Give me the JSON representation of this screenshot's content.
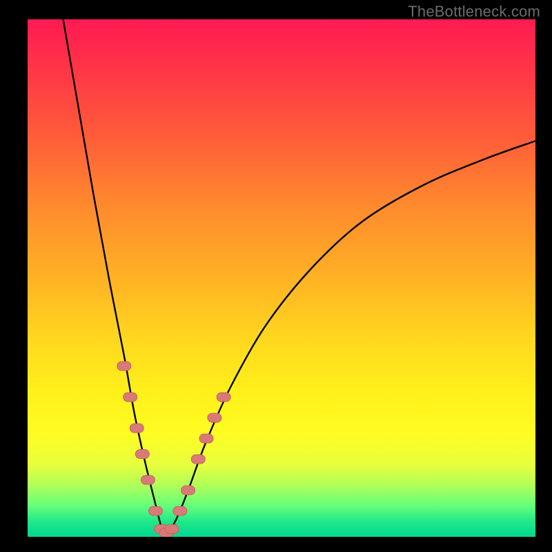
{
  "watermark": "TheBottleneck.com",
  "colors": {
    "frame": "#000000",
    "curve": "#000000",
    "marker_fill": "#d97a78",
    "marker_stroke": "#c46560",
    "gradient_top": "#ff1a52",
    "gradient_bottom": "#00d890"
  },
  "chart_data": {
    "type": "line",
    "title": "",
    "xlabel": "",
    "ylabel": "",
    "xlim": [
      0,
      100
    ],
    "ylim": [
      0,
      100
    ],
    "grid": false,
    "legend": false,
    "note": "Bottleneck-style V-curve. No axis ticks or numeric labels are rendered; y is read as percentage of plot height (0 at bottom, 100 at top). Minimum (~0) near x≈27.",
    "series": [
      {
        "name": "left-branch",
        "x": [
          7,
          10,
          13,
          16,
          19,
          21,
          23,
          25,
          26.3,
          27
        ],
        "y": [
          100,
          83,
          66,
          50,
          35,
          24,
          15,
          7,
          2,
          0.5
        ]
      },
      {
        "name": "right-branch",
        "x": [
          27,
          28.5,
          30,
          32,
          35,
          40,
          47,
          56,
          66,
          78,
          90,
          100
        ],
        "y": [
          0.5,
          2,
          5,
          10,
          18,
          29,
          41,
          52,
          61,
          68,
          73,
          76.5
        ]
      }
    ],
    "markers": {
      "name": "highlighted-points",
      "note": "Salmon lozenge markers clustered around the trough on both branches.",
      "points": [
        {
          "x": 19.0,
          "y": 33
        },
        {
          "x": 20.2,
          "y": 27
        },
        {
          "x": 21.5,
          "y": 21
        },
        {
          "x": 22.6,
          "y": 16
        },
        {
          "x": 23.7,
          "y": 11
        },
        {
          "x": 25.2,
          "y": 5
        },
        {
          "x": 26.3,
          "y": 1.5
        },
        {
          "x": 27.3,
          "y": 0.8
        },
        {
          "x": 28.4,
          "y": 1.5
        },
        {
          "x": 30.0,
          "y": 5
        },
        {
          "x": 31.6,
          "y": 9
        },
        {
          "x": 33.6,
          "y": 15
        },
        {
          "x": 35.2,
          "y": 19
        },
        {
          "x": 36.8,
          "y": 23
        },
        {
          "x": 38.6,
          "y": 27
        }
      ]
    }
  }
}
